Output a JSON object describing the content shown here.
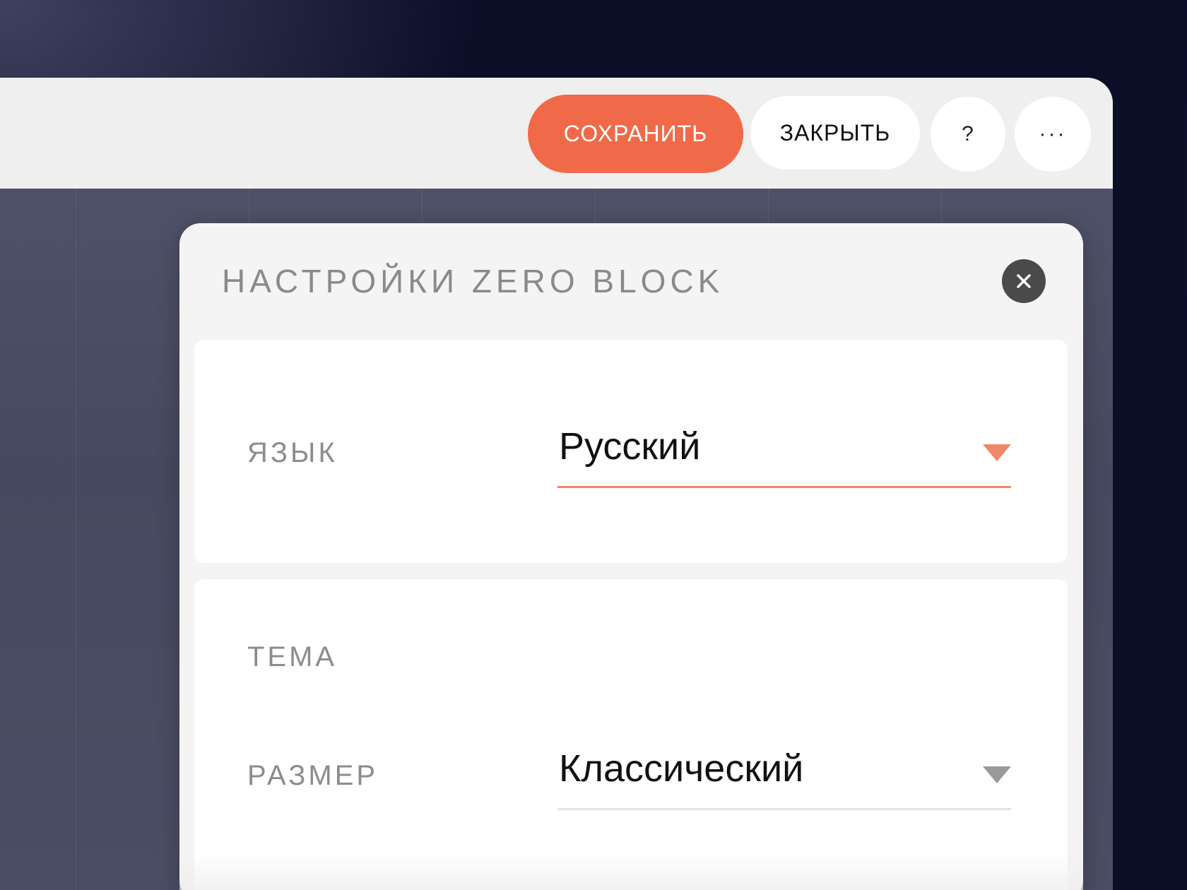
{
  "toolbar": {
    "save_label": "СОХРАНИТЬ",
    "close_label": "ЗАКРЫТЬ",
    "help_label": "?",
    "more_label": "···"
  },
  "panel": {
    "title": "НАСТРОЙКИ ZERO BLOCK",
    "close_icon": "close-icon"
  },
  "language": {
    "label": "ЯЗЫК",
    "value": "Русский",
    "accent_color": "#f0876a"
  },
  "theme": {
    "label": "ТЕМА",
    "size_label": "РАЗМЕР",
    "size_value": "Классический",
    "arrow_color": "#9a9a9a"
  },
  "colors": {
    "accent": "#f06a4a",
    "background": "#0c0e28"
  }
}
